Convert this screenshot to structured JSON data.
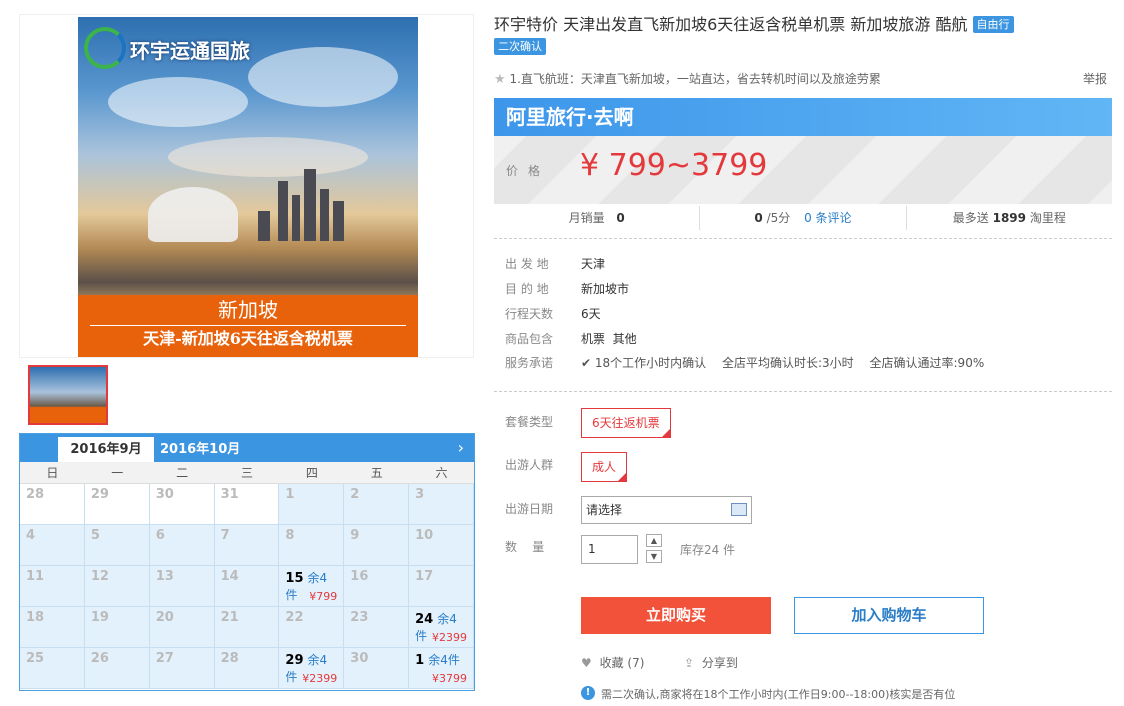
{
  "product": {
    "title": "环宇特价 天津出发直飞新加坡6天往返含税单机票 新加坡旅游 酷航",
    "tags": [
      "自由行",
      "二次确认"
    ],
    "subtitle": "1.直飞航班：天津直飞新加坡，一站直达，省去转机时间以及旅途劳累",
    "report": "举报",
    "image": {
      "logo_text": "环宇运通国旅",
      "banner_line1": "新加坡",
      "banner_line2": "天津-新加坡6天往返含税机票"
    }
  },
  "calendar": {
    "month_current": "2016年9月",
    "month_next": "2016年10月",
    "next_icon": "›",
    "weekdays": [
      "日",
      "一",
      "二",
      "三",
      "四",
      "五",
      "六"
    ],
    "days": [
      {
        "d": "28"
      },
      {
        "d": "29"
      },
      {
        "d": "30"
      },
      {
        "d": "31"
      },
      {
        "d": "1"
      },
      {
        "d": "2"
      },
      {
        "d": "3"
      },
      {
        "d": "4"
      },
      {
        "d": "5"
      },
      {
        "d": "6"
      },
      {
        "d": "7"
      },
      {
        "d": "8"
      },
      {
        "d": "9"
      },
      {
        "d": "10"
      },
      {
        "d": "11"
      },
      {
        "d": "12"
      },
      {
        "d": "13"
      },
      {
        "d": "14"
      },
      {
        "d": "15",
        "rem": "余4件",
        "price": "¥799"
      },
      {
        "d": "16"
      },
      {
        "d": "17"
      },
      {
        "d": "18"
      },
      {
        "d": "19"
      },
      {
        "d": "20"
      },
      {
        "d": "21"
      },
      {
        "d": "22"
      },
      {
        "d": "23"
      },
      {
        "d": "24",
        "rem": "余4件",
        "price": "¥2399"
      },
      {
        "d": "25"
      },
      {
        "d": "26"
      },
      {
        "d": "27"
      },
      {
        "d": "28"
      },
      {
        "d": "29",
        "rem": "余4件",
        "price": "¥2399"
      },
      {
        "d": "30"
      },
      {
        "d": "1",
        "rem": "余4件",
        "price": "¥3799"
      }
    ]
  },
  "promo": {
    "brand": "阿里旅行·去啊",
    "price_label": "价格",
    "price": "¥ 799~3799"
  },
  "stats": {
    "monthly_label": "月销量",
    "monthly_value": "0",
    "rating_value": "0",
    "rating_suffix": "/5分",
    "reviews": "0 条评论",
    "points_prefix": "最多送",
    "points_value": "1899",
    "points_suffix": "淘里程"
  },
  "info": [
    {
      "label": "出 发 地",
      "value": "天津"
    },
    {
      "label": "目 的 地",
      "value": "新加坡市"
    },
    {
      "label": "行程天数",
      "value": "6天"
    },
    {
      "label": "商品包含",
      "value": "机票  其他"
    }
  ],
  "service": {
    "label": "服务承诺",
    "item1": "18个工作小时内确认",
    "item2": "全店平均确认时长:3小时",
    "item3": "全店确认通过率:90%"
  },
  "options": {
    "package_label": "套餐类型",
    "package_value": "6天往返机票",
    "people_label": "出游人群",
    "people_value": "成人",
    "date_label": "出游日期",
    "date_placeholder": "请选择",
    "qty_label": "数    量",
    "qty_value": "1",
    "stock": "库存24 件"
  },
  "actions": {
    "buy": "立即购买",
    "cart": "加入购物车",
    "favorite": "收藏 (7)",
    "share": "分享到"
  },
  "notice": "需二次确认,商家将在18个工作小时内(工作日9:00--18:00)核实是否有位"
}
